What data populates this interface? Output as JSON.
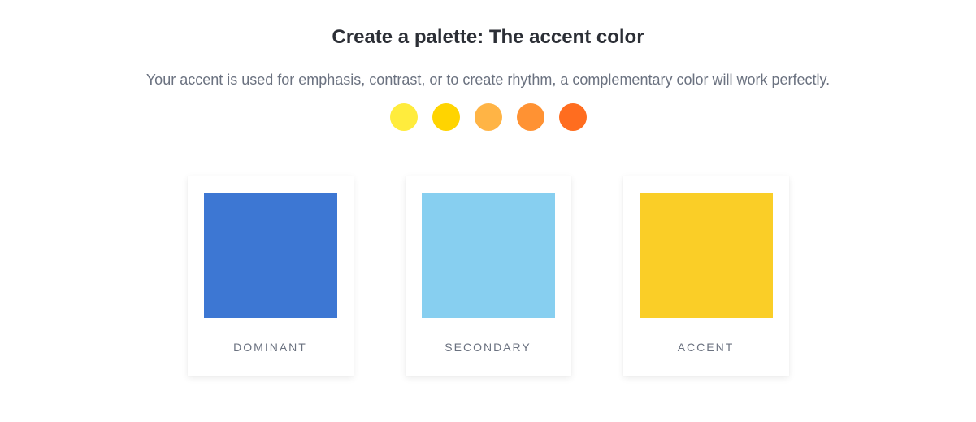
{
  "title": "Create a palette: The accent color",
  "subtitle": "Your accent is used for emphasis, contrast, or to create rhythm, a complementary color will work perfectly.",
  "swatches": [
    {
      "name": "swatch-1",
      "color": "#FFEC3D"
    },
    {
      "name": "swatch-2",
      "color": "#FFD400"
    },
    {
      "name": "swatch-3",
      "color": "#FFB445"
    },
    {
      "name": "swatch-4",
      "color": "#FF9233"
    },
    {
      "name": "swatch-5",
      "color": "#FF6D1F"
    }
  ],
  "cards": [
    {
      "label": "DOMINANT",
      "color": "#3D77D3"
    },
    {
      "label": "SECONDARY",
      "color": "#87CFF0"
    },
    {
      "label": "ACCENT",
      "color": "#FACE27"
    }
  ]
}
